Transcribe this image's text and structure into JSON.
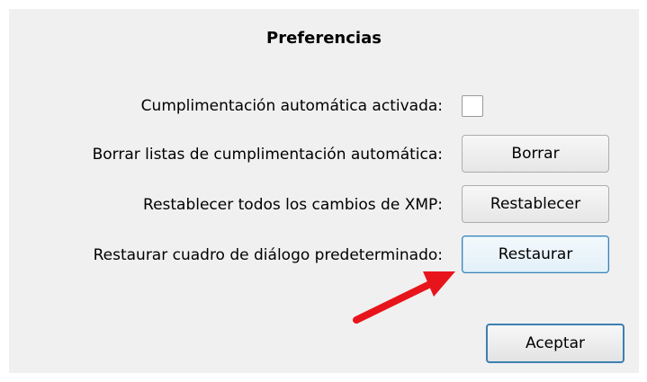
{
  "dialog": {
    "title": "Preferencias",
    "rows": [
      {
        "label": "Cumplimentación automática activada:",
        "control": "checkbox",
        "checked": false
      },
      {
        "label": "Borrar listas de cumplimentación automática:",
        "control": "button",
        "button_label": "Borrar"
      },
      {
        "label": "Restablecer todos los cambios de XMP:",
        "control": "button",
        "button_label": "Restablecer"
      },
      {
        "label": "Restaurar cuadro de diálogo predeterminado:",
        "control": "button",
        "button_label": "Restaurar"
      }
    ],
    "ok_button": "Aceptar"
  },
  "annotation": {
    "arrow_color": "#e8141b",
    "arrow_target": "restore-button"
  }
}
